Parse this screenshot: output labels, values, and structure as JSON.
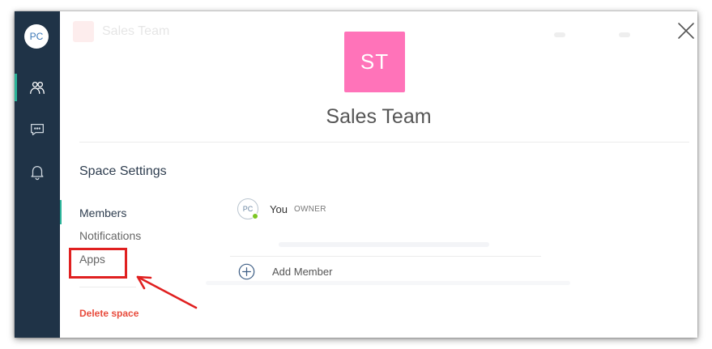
{
  "user": {
    "initials": "PC"
  },
  "rail": {
    "items": [
      {
        "name": "people-icon",
        "active": true
      },
      {
        "name": "chat-icon",
        "active": false
      },
      {
        "name": "bell-icon",
        "active": false
      }
    ]
  },
  "background_header": {
    "title": "Sales Team"
  },
  "space": {
    "initials": "ST",
    "name": "Sales Team",
    "avatar_color": "#ff73b9"
  },
  "settings": {
    "title": "Space Settings",
    "nav": [
      {
        "label": "Members",
        "active": true
      },
      {
        "label": "Notifications",
        "active": false
      },
      {
        "label": "Apps",
        "active": false
      }
    ],
    "delete_label": "Delete space"
  },
  "members": [
    {
      "initials": "PC",
      "name": "You",
      "role": "OWNER",
      "online": true
    }
  ],
  "add_member": {
    "label": "Add Member"
  },
  "colors": {
    "rail_bg": "#1f3347",
    "accent": "#2bb59a",
    "danger": "#e84c3d",
    "annotation": "#e02020",
    "status_online": "#7cc624"
  }
}
